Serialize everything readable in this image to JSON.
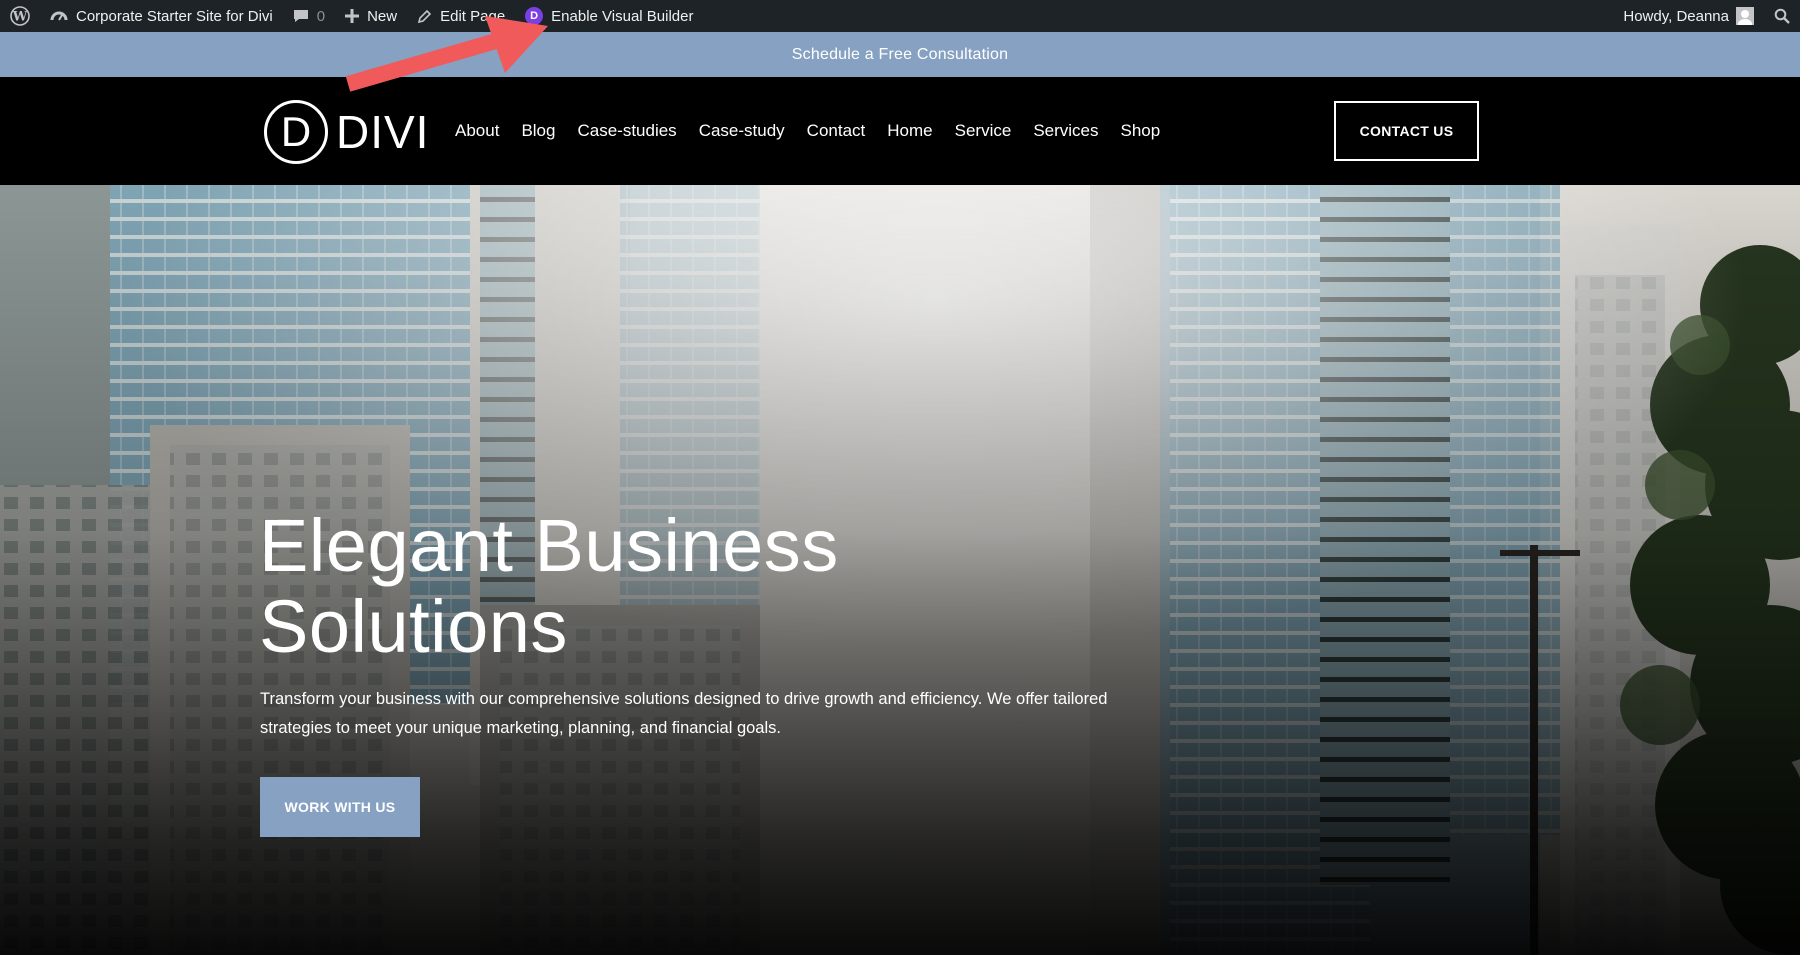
{
  "admin_bar": {
    "site_name": "Corporate Starter Site for Divi",
    "comments_count": "0",
    "new_label": "New",
    "edit_label": "Edit Page",
    "visual_builder_label": "Enable Visual Builder",
    "greeting": "Howdy, Deanna"
  },
  "announcement": {
    "text": "Schedule a Free Consultation"
  },
  "header": {
    "logo_letter": "D",
    "logo_text": "DIVI",
    "nav": [
      "About",
      "Blog",
      "Case-studies",
      "Case-study",
      "Contact",
      "Home",
      "Service",
      "Services",
      "Shop"
    ],
    "cta_label": "CONTACT US"
  },
  "hero": {
    "title_line1": "Elegant Business",
    "title_line2": "Solutions",
    "description": "Transform your business with our comprehensive solutions designed to drive growth and efficiency. We offer tailored strategies to meet your unique marketing, planning, and financial goals.",
    "button_label": "WORK WITH US"
  },
  "colors": {
    "admin_bar": "#1d2327",
    "accent": "#86a1c2",
    "header_bg": "#000000",
    "annotation_arrow": "#f05a5a"
  }
}
